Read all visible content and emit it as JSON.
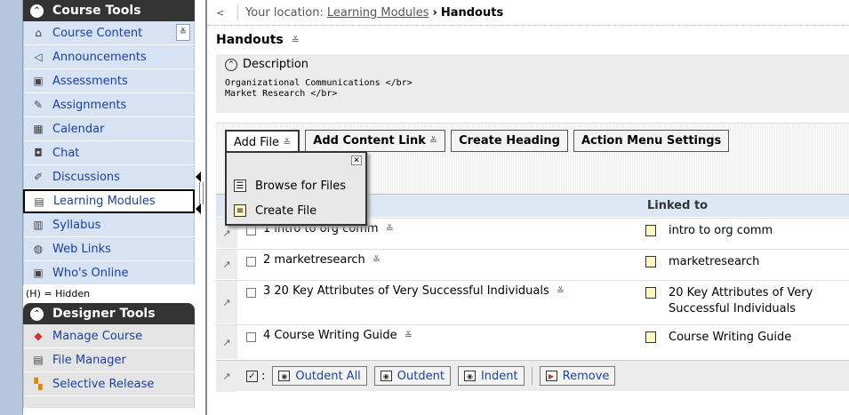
{
  "sidebar": {
    "course_tools_title": "Course Tools",
    "designer_tools_title": "Designer Tools",
    "hidden_note": "(H) = Hidden",
    "course_items": [
      {
        "label": "Course Content",
        "icon": "home-icon"
      },
      {
        "label": "Announcements",
        "icon": "megaphone-icon"
      },
      {
        "label": "Assessments",
        "icon": "assessment-icon"
      },
      {
        "label": "Assignments",
        "icon": "assignment-icon"
      },
      {
        "label": "Calendar",
        "icon": "calendar-icon"
      },
      {
        "label": "Chat",
        "icon": "chat-icon"
      },
      {
        "label": "Discussions",
        "icon": "discussion-icon"
      },
      {
        "label": "Learning Modules",
        "icon": "module-icon"
      },
      {
        "label": "Syllabus",
        "icon": "syllabus-icon"
      },
      {
        "label": "Web Links",
        "icon": "globe-icon"
      },
      {
        "label": "Who's Online",
        "icon": "user-icon"
      }
    ],
    "designer_items": [
      {
        "label": "Manage Course",
        "icon": "manage-icon"
      },
      {
        "label": "File Manager",
        "icon": "file-manager-icon"
      },
      {
        "label": "Selective Release",
        "icon": "release-icon"
      }
    ]
  },
  "breadcrumb": {
    "prefix": "Your location:",
    "link": "Learning Modules",
    "separator": "›",
    "current": "Handouts"
  },
  "page": {
    "title": "Handouts",
    "description_label": "Description",
    "description_lines": [
      "Organizational Communications </br>",
      "Market Research </br>"
    ]
  },
  "toolbar": {
    "add_file": "Add File",
    "add_content_link": "Add Content Link",
    "create_heading": "Create Heading",
    "action_menu_settings": "Action Menu Settings"
  },
  "dropdown": {
    "items": [
      "Browse for Files",
      "Create File"
    ]
  },
  "table": {
    "linked_header": "Linked to",
    "rows": [
      {
        "title": "1 intro to org comm",
        "linked": "intro to org comm"
      },
      {
        "title": "2 marketresearch",
        "linked": "marketresearch"
      },
      {
        "title": "3 20 Key Attributes of Very Successful Individuals",
        "linked": "20 Key Attributes of Very Successful Individuals"
      },
      {
        "title": "4 Course Writing Guide",
        "linked": "Course Writing Guide"
      }
    ],
    "check_colon": ":",
    "actions": {
      "outdent_all": "Outdent All",
      "outdent": "Outdent",
      "indent": "Indent",
      "remove": "Remove"
    }
  }
}
